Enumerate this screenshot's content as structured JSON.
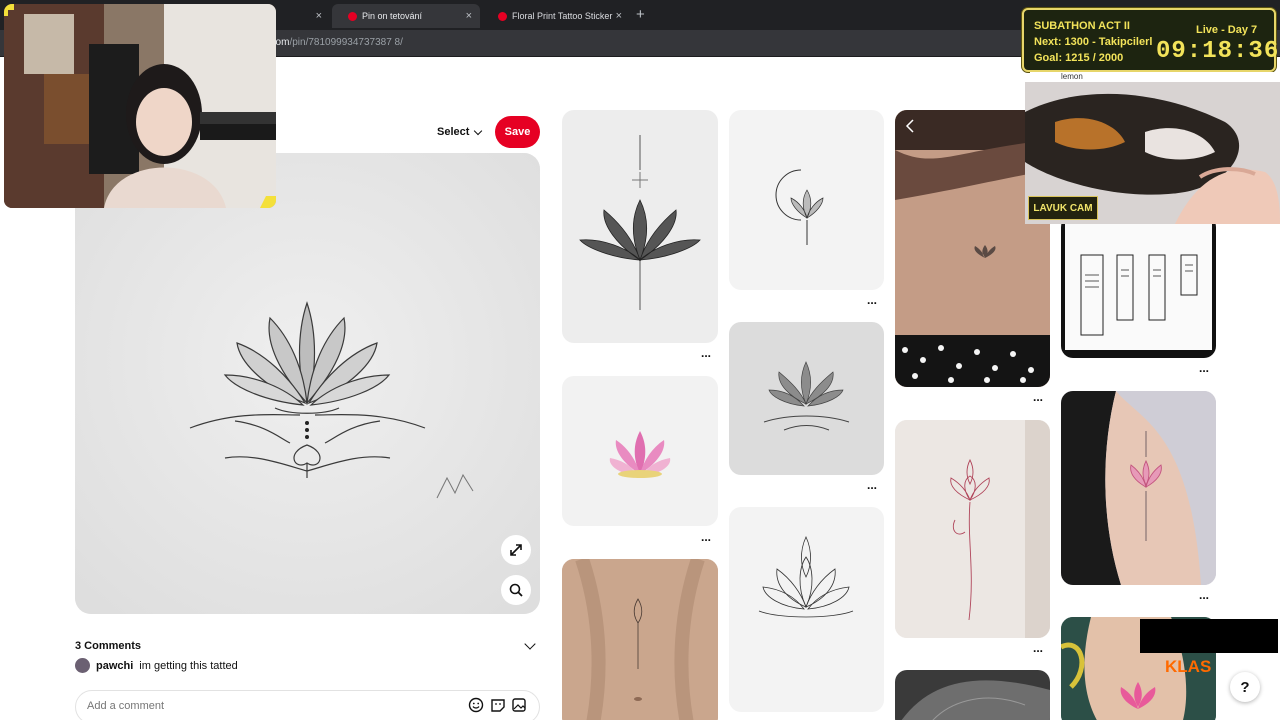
{
  "browser": {
    "tabs": [
      {
        "label": "",
        "active": false
      },
      {
        "label": "Pin on tetování",
        "active": true
      },
      {
        "label": "Floral Print Tattoo Sticker",
        "active": false
      }
    ],
    "new_tab_icon": "plus-icon",
    "close_icon": "×",
    "url_host": "st.com",
    "url_path": "/pin/781099934737387 8/"
  },
  "pin": {
    "select_label": "Select",
    "save_label": "Save",
    "comments_title": "3 Comments",
    "comment_user": "pawchi",
    "comment_text": "im getting this tatted",
    "comment_placeholder": "Add a comment",
    "accent_color": "#e60023"
  },
  "feed": {
    "more_label": "..."
  },
  "overlay": {
    "subathon_title": "SUBATHON ACT II",
    "subathon_day": "Live - Day 7",
    "subathon_next": "Next: 1300 - Takipcilerl",
    "subathon_goal": "Goal: 1215 / 2000",
    "subathon_timer": "09:18:36",
    "chat_user": "lemon",
    "cam_label": "LAVUK CAM",
    "brand": "KLAS",
    "help": "?"
  }
}
